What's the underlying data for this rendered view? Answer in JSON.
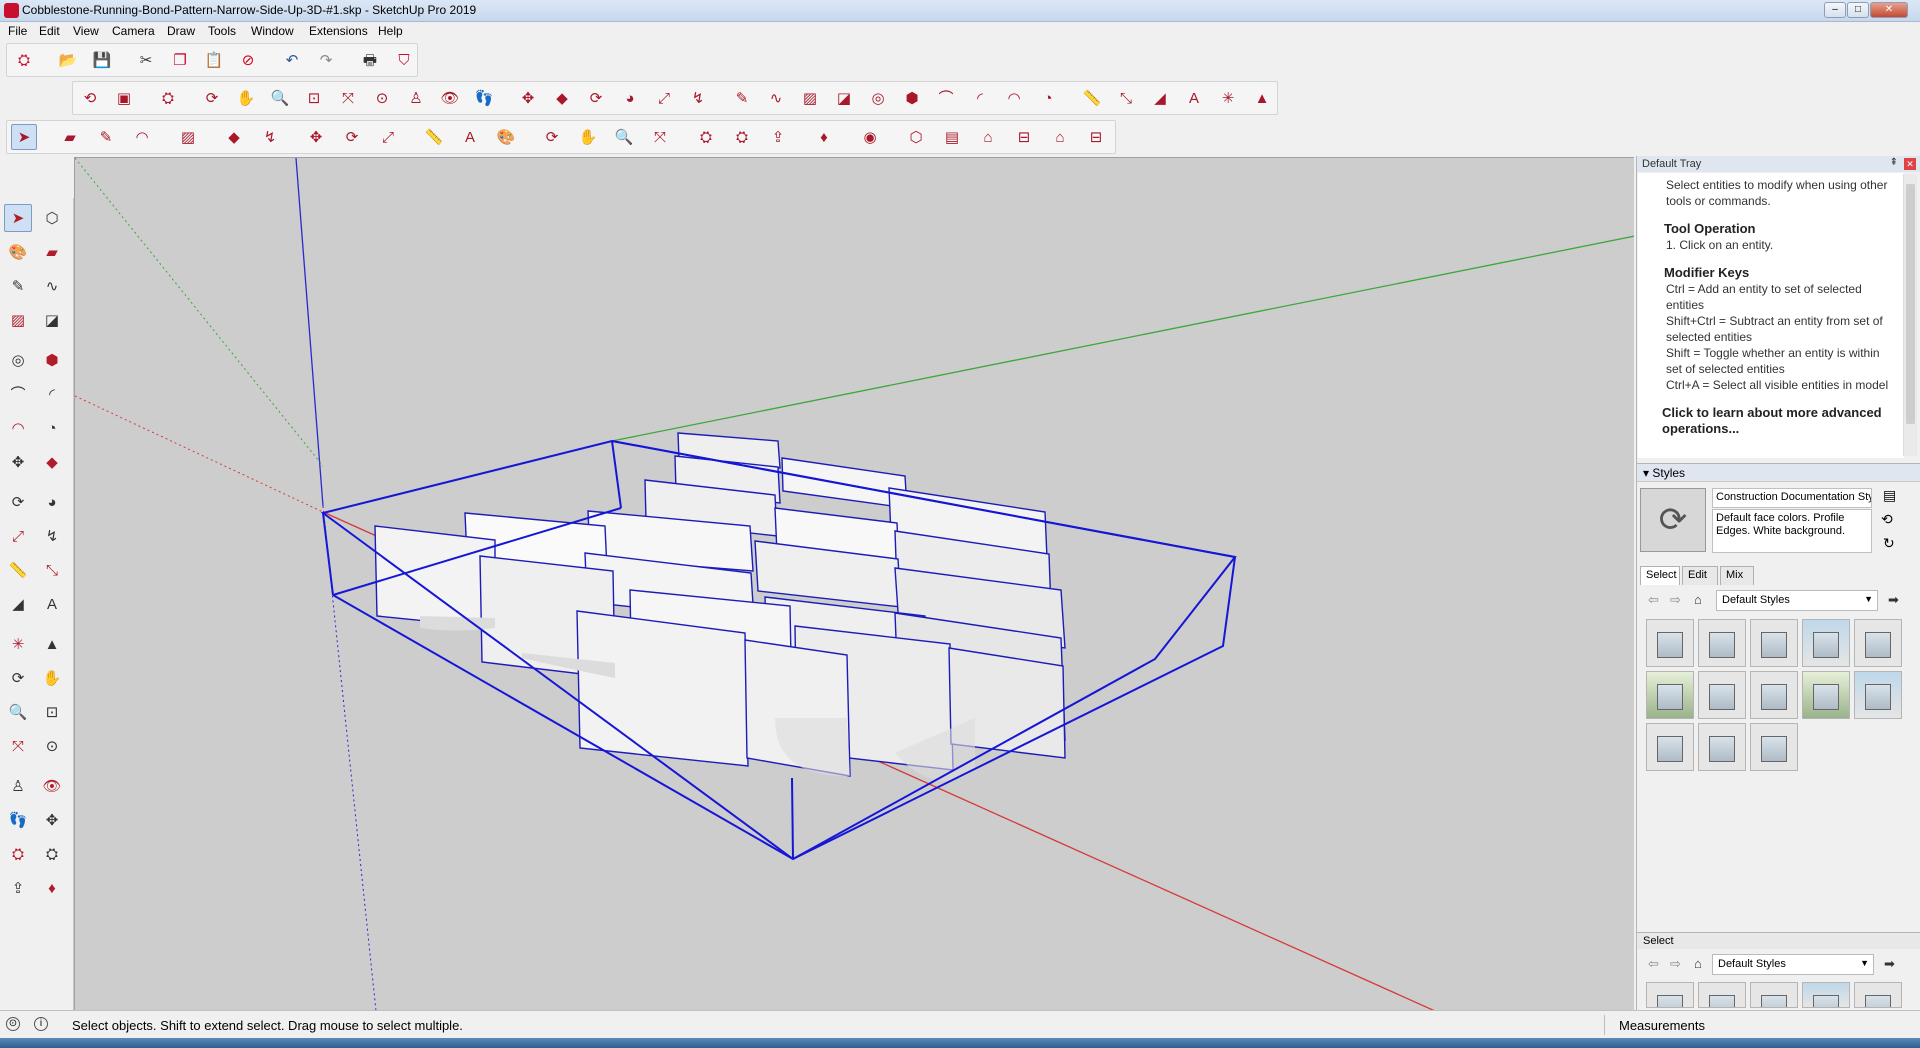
{
  "window": {
    "title": "Cobblestone-Running-Bond-Pattern-Narrow-Side-Up-3D-#1.skp - SketchUp Pro 2019",
    "minimize": "–",
    "maximize": "□",
    "close": "✕"
  },
  "menu": [
    "File",
    "Edit",
    "View",
    "Camera",
    "Draw",
    "Tools",
    "Window",
    "Extensions",
    "Help"
  ],
  "toolbar1": [
    {
      "name": "warehouse-icon",
      "glyph": "⛭",
      "color": "#c8102e"
    },
    {
      "name": "open-icon",
      "glyph": "📂",
      "color": "#c98b1d"
    },
    {
      "name": "save-icon",
      "glyph": "💾",
      "color": "#2b5797"
    },
    {
      "name": "cut-icon",
      "glyph": "✂",
      "color": "#333"
    },
    {
      "name": "copy-icon",
      "glyph": "❐",
      "color": "#c8102e"
    },
    {
      "name": "paste-icon",
      "glyph": "📋",
      "color": "#777"
    },
    {
      "name": "erase-icon",
      "glyph": "⊘",
      "color": "#d0021b"
    },
    {
      "name": "undo-icon",
      "glyph": "↶",
      "color": "#2b5797"
    },
    {
      "name": "redo-icon",
      "glyph": "↷",
      "color": "#888"
    },
    {
      "name": "print-icon",
      "glyph": "🖶",
      "color": "#333"
    },
    {
      "name": "model-info-icon",
      "glyph": "⛉",
      "color": "#c8102e"
    }
  ],
  "toolbar2": [
    {
      "name": "arc-icon",
      "glyph": "⟲"
    },
    {
      "name": "camera-icon",
      "glyph": "▣"
    },
    {
      "name": "extension-icon",
      "glyph": "⛭"
    },
    {
      "name": "orbit-icon",
      "glyph": "⟳"
    },
    {
      "name": "pan-icon",
      "glyph": "✋"
    },
    {
      "name": "zoom-icon",
      "glyph": "🔍"
    },
    {
      "name": "zoom-window-icon",
      "glyph": "⊡"
    },
    {
      "name": "zoom-extents-icon",
      "glyph": "⤧"
    },
    {
      "name": "previous-icon",
      "glyph": "⊙"
    },
    {
      "name": "position-camera-icon",
      "glyph": "♙"
    },
    {
      "name": "look-around-icon",
      "glyph": "👁"
    },
    {
      "name": "walk-icon",
      "glyph": "👣"
    },
    {
      "name": "move-icon",
      "glyph": "✥"
    },
    {
      "name": "push-pull-icon",
      "glyph": "◆"
    },
    {
      "name": "rotate-icon",
      "glyph": "⟳"
    },
    {
      "name": "follow-me-icon",
      "glyph": "◕"
    },
    {
      "name": "scale-icon",
      "glyph": "⤢"
    },
    {
      "name": "offset-icon",
      "glyph": "↯"
    },
    {
      "name": "pencil-icon",
      "glyph": "✎"
    },
    {
      "name": "freehand-icon",
      "glyph": "∿"
    },
    {
      "name": "rectangle-icon",
      "glyph": "▨"
    },
    {
      "name": "rotated-rectangle-icon",
      "glyph": "◪"
    },
    {
      "name": "circle-icon",
      "glyph": "◎"
    },
    {
      "name": "polygon-icon",
      "glyph": "⬢"
    },
    {
      "name": "arc2-icon",
      "glyph": "⌒"
    },
    {
      "name": "arc3-icon",
      "glyph": "◜"
    },
    {
      "name": "arc-center-icon",
      "glyph": "◠"
    },
    {
      "name": "pie-icon",
      "glyph": "◔"
    },
    {
      "name": "tape-icon",
      "glyph": "📏"
    },
    {
      "name": "dimension-icon",
      "glyph": "⤡"
    },
    {
      "name": "protractor-icon",
      "glyph": "◢"
    },
    {
      "name": "text-icon",
      "glyph": "A"
    },
    {
      "name": "axes-icon",
      "glyph": "✳"
    },
    {
      "name": "3d-text-icon",
      "glyph": "▲"
    }
  ],
  "toolbar3": [
    {
      "name": "select-icon",
      "glyph": "➤"
    },
    {
      "name": "eraser-icon",
      "glyph": "▰"
    },
    {
      "name": "line-icon",
      "glyph": "✎"
    },
    {
      "name": "arc-tool-icon",
      "glyph": "◠"
    },
    {
      "name": "shape-icon",
      "glyph": "▨"
    },
    {
      "name": "pushpull-icon",
      "glyph": "◆"
    },
    {
      "name": "offset-tool-icon",
      "glyph": "↯"
    },
    {
      "name": "move-tool-icon",
      "glyph": "✥"
    },
    {
      "name": "rotate-tool-icon",
      "glyph": "⟳"
    },
    {
      "name": "scale-tool-icon",
      "glyph": "⤢"
    },
    {
      "name": "tape-tool-icon",
      "glyph": "📏"
    },
    {
      "name": "text-tool-icon",
      "glyph": "A"
    },
    {
      "name": "paint-icon",
      "glyph": "🎨"
    },
    {
      "name": "orbit-tool-icon",
      "glyph": "⟳"
    },
    {
      "name": "pan-tool-icon",
      "glyph": "✋"
    },
    {
      "name": "zoom-tool-icon",
      "glyph": "🔍"
    },
    {
      "name": "zoom-extents-tool-icon",
      "glyph": "⤧"
    },
    {
      "name": "warehouse-tool-icon",
      "glyph": "⛭"
    },
    {
      "name": "extension-warehouse-icon",
      "glyph": "⛭"
    },
    {
      "name": "share-icon",
      "glyph": "⇪"
    },
    {
      "name": "ruby-icon",
      "glyph": "♦"
    },
    {
      "name": "account-icon",
      "glyph": "◉"
    },
    {
      "name": "iso-icon",
      "glyph": "⬡"
    },
    {
      "name": "top-icon",
      "glyph": "▤"
    },
    {
      "name": "front-icon",
      "glyph": "⌂"
    },
    {
      "name": "right-icon",
      "glyph": "⊟"
    },
    {
      "name": "back-icon",
      "glyph": "⌂"
    },
    {
      "name": "left-icon",
      "glyph": "⊟"
    }
  ],
  "left_tools": [
    {
      "name": "select-icon",
      "glyph": "➤"
    },
    {
      "name": "component-icon",
      "glyph": "⬡"
    },
    {
      "name": "paint-bucket-icon",
      "glyph": "🎨"
    },
    {
      "name": "eraser-icon",
      "glyph": "▰"
    },
    {
      "name": "line-icon",
      "glyph": "✎"
    },
    {
      "name": "freehand-icon",
      "glyph": "∿"
    },
    {
      "name": "rectangle-icon",
      "glyph": "▨"
    },
    {
      "name": "rotated-rect-icon",
      "glyph": "◪"
    },
    {
      "name": "circle-icon",
      "glyph": "◎"
    },
    {
      "name": "polygon-icon",
      "glyph": "⬢"
    },
    {
      "name": "arc-icon",
      "glyph": "⌒"
    },
    {
      "name": "arc2-icon",
      "glyph": "◜"
    },
    {
      "name": "arc3-icon",
      "glyph": "◠"
    },
    {
      "name": "pie-icon",
      "glyph": "◔"
    },
    {
      "name": "move-icon",
      "glyph": "✥"
    },
    {
      "name": "push-pull-icon",
      "glyph": "◆"
    },
    {
      "name": "rotate-icon",
      "glyph": "⟳"
    },
    {
      "name": "follow-me-icon",
      "glyph": "◕"
    },
    {
      "name": "scale-icon",
      "glyph": "⤢"
    },
    {
      "name": "offset-icon",
      "glyph": "↯"
    },
    {
      "name": "tape-icon",
      "glyph": "📏"
    },
    {
      "name": "dimension-icon",
      "glyph": "⤡"
    },
    {
      "name": "protractor-icon",
      "glyph": "◢"
    },
    {
      "name": "text-icon",
      "glyph": "A"
    },
    {
      "name": "axes-icon",
      "glyph": "✳"
    },
    {
      "name": "3d-text-icon",
      "glyph": "▲"
    },
    {
      "name": "orbit-icon",
      "glyph": "⟳"
    },
    {
      "name": "pan-icon",
      "glyph": "✋"
    },
    {
      "name": "zoom-icon",
      "glyph": "🔍"
    },
    {
      "name": "zoom-window-icon",
      "glyph": "⊡"
    },
    {
      "name": "zoom-extents-icon",
      "glyph": "⤧"
    },
    {
      "name": "previous-view-icon",
      "glyph": "⊙"
    },
    {
      "name": "position-camera-icon",
      "glyph": "♙"
    },
    {
      "name": "look-around-icon",
      "glyph": "👁"
    },
    {
      "name": "walk-icon",
      "glyph": "👣"
    },
    {
      "name": "section-plane-icon",
      "glyph": "✥"
    },
    {
      "name": "warehouse-icon",
      "glyph": "⛭"
    },
    {
      "name": "extension-warehouse-icon",
      "glyph": "⛭"
    },
    {
      "name": "send-to-layout-icon",
      "glyph": "⇪"
    },
    {
      "name": "ruby-console-icon",
      "glyph": "♦"
    }
  ],
  "tray": {
    "title": "Default Tray",
    "pin": "⇞",
    "close": "✕",
    "instructor": {
      "intro": "Select entities to modify when using other tools or commands.",
      "tool_operation_heading": "Tool Operation",
      "tool_operation_step": "1. Click on an entity.",
      "modifier_keys_heading": "Modifier Keys",
      "modifier_keys": [
        "Ctrl = Add an entity to set of selected entities",
        "Shift+Ctrl = Subtract an entity from set of selected entities",
        "Shift = Toggle whether an entity is within set of selected entities",
        "Ctrl+A = Select all visible entities in model"
      ],
      "learn_more": "Click to learn about more advanced operations..."
    },
    "styles": {
      "header": "▾ Styles",
      "style_name": "Construction Documentation Sty",
      "style_description": "Default face colors. Profile Edges. White background.",
      "tabs": [
        "Select",
        "Edit",
        "Mix"
      ],
      "collection": "Default Styles",
      "bottom_header": "Select",
      "bottom_collection": "Default Styles"
    }
  },
  "status": {
    "message": "Select objects. Shift to extend select. Drag mouse to select multiple.",
    "measurements_label": "Measurements"
  },
  "colors": {
    "axis_red": "#d43a3a",
    "axis_green": "#3aa83a",
    "axis_blue": "#2a2acb",
    "bounding_box": "#1616d6",
    "stone_fill": "#f2f2f2",
    "viewport_bg": "#cdcdcd"
  }
}
